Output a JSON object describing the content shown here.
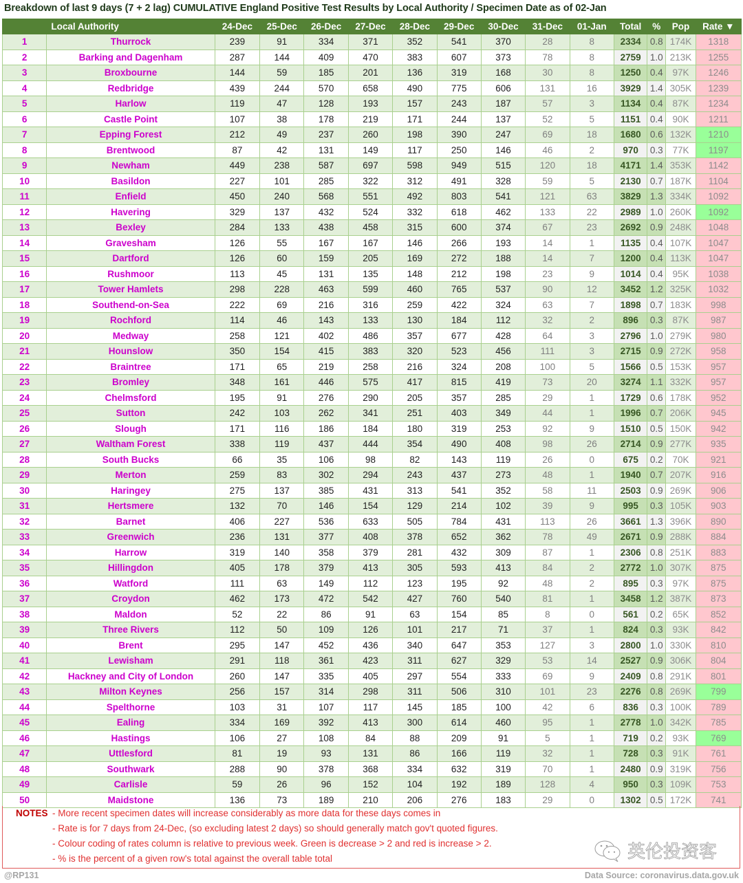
{
  "title": "Breakdown of last 9 days (7 + 2 lag)  CUMULATIVE England Positive Test Results by Local Authority / Specimen Date as of 02-Jan",
  "colors": {
    "header_bg": "#548235",
    "row_alt_bg": "#e2efda",
    "name_text": "#cc00cc",
    "rate_increase": "#ffc7ce",
    "rate_decrease": "#99ff99",
    "notes_text": "#e03030"
  },
  "chart_data": {
    "type": "table",
    "title": "Breakdown of last 9 days (7 + 2 lag)  CUMULATIVE England Positive Test Results by Local Authority / Specimen Date as of 02-Jan",
    "columns": [
      "",
      "Local Authority",
      "24-Dec",
      "25-Dec",
      "26-Dec",
      "27-Dec",
      "28-Dec",
      "29-Dec",
      "30-Dec",
      "31-Dec",
      "01-Jan",
      "Total",
      "%",
      "Pop",
      "Rate ▼"
    ],
    "header_label": "Local Authority",
    "day_headers": [
      "24-Dec",
      "25-Dec",
      "26-Dec",
      "27-Dec",
      "28-Dec",
      "29-Dec",
      "30-Dec",
      "31-Dec",
      "01-Jan"
    ],
    "total_header": "Total",
    "pct_header": "%",
    "pop_header": "Pop",
    "rate_header": "Rate ▼",
    "lag_days": 2,
    "rows": [
      {
        "rank": "1",
        "name": "Thurrock",
        "days": [
          239,
          91,
          334,
          371,
          352,
          541,
          370,
          28,
          8
        ],
        "total": "2334",
        "pct": "0.8",
        "pop": "174K",
        "rate": "1318",
        "rate_flag": "increase"
      },
      {
        "rank": "2",
        "name": "Barking and Dagenham",
        "days": [
          287,
          144,
          409,
          470,
          383,
          607,
          373,
          78,
          8
        ],
        "total": "2759",
        "pct": "1.0",
        "pop": "213K",
        "rate": "1255",
        "rate_flag": "increase"
      },
      {
        "rank": "3",
        "name": "Broxbourne",
        "days": [
          144,
          59,
          185,
          201,
          136,
          319,
          168,
          30,
          8
        ],
        "total": "1250",
        "pct": "0.4",
        "pop": "97K",
        "rate": "1246",
        "rate_flag": "increase"
      },
      {
        "rank": "4",
        "name": "Redbridge",
        "days": [
          439,
          244,
          570,
          658,
          490,
          775,
          606,
          131,
          16
        ],
        "total": "3929",
        "pct": "1.4",
        "pop": "305K",
        "rate": "1239",
        "rate_flag": "increase"
      },
      {
        "rank": "5",
        "name": "Harlow",
        "days": [
          119,
          47,
          128,
          193,
          157,
          243,
          187,
          57,
          3
        ],
        "total": "1134",
        "pct": "0.4",
        "pop": "87K",
        "rate": "1234",
        "rate_flag": "increase"
      },
      {
        "rank": "6",
        "name": "Castle Point",
        "days": [
          107,
          38,
          178,
          219,
          171,
          244,
          137,
          52,
          5
        ],
        "total": "1151",
        "pct": "0.4",
        "pop": "90K",
        "rate": "1211",
        "rate_flag": "increase"
      },
      {
        "rank": "7",
        "name": "Epping Forest",
        "days": [
          212,
          49,
          237,
          260,
          198,
          390,
          247,
          69,
          18
        ],
        "total": "1680",
        "pct": "0.6",
        "pop": "132K",
        "rate": "1210",
        "rate_flag": "decrease"
      },
      {
        "rank": "8",
        "name": "Brentwood",
        "days": [
          87,
          42,
          131,
          149,
          117,
          250,
          146,
          46,
          2
        ],
        "total": "970",
        "pct": "0.3",
        "pop": "77K",
        "rate": "1197",
        "rate_flag": "decrease"
      },
      {
        "rank": "9",
        "name": "Newham",
        "days": [
          449,
          238,
          587,
          697,
          598,
          949,
          515,
          120,
          18
        ],
        "total": "4171",
        "pct": "1.4",
        "pop": "353K",
        "rate": "1142",
        "rate_flag": "increase"
      },
      {
        "rank": "10",
        "name": "Basildon",
        "days": [
          227,
          101,
          285,
          322,
          312,
          491,
          328,
          59,
          5
        ],
        "total": "2130",
        "pct": "0.7",
        "pop": "187K",
        "rate": "1104",
        "rate_flag": "increase"
      },
      {
        "rank": "11",
        "name": "Enfield",
        "days": [
          450,
          240,
          568,
          551,
          492,
          803,
          541,
          121,
          63
        ],
        "total": "3829",
        "pct": "1.3",
        "pop": "334K",
        "rate": "1092",
        "rate_flag": "increase"
      },
      {
        "rank": "12",
        "name": "Havering",
        "days": [
          329,
          137,
          432,
          524,
          332,
          618,
          462,
          133,
          22
        ],
        "total": "2989",
        "pct": "1.0",
        "pop": "260K",
        "rate": "1092",
        "rate_flag": "decrease"
      },
      {
        "rank": "13",
        "name": "Bexley",
        "days": [
          284,
          133,
          438,
          458,
          315,
          600,
          374,
          67,
          23
        ],
        "total": "2692",
        "pct": "0.9",
        "pop": "248K",
        "rate": "1048",
        "rate_flag": "increase"
      },
      {
        "rank": "14",
        "name": "Gravesham",
        "days": [
          126,
          55,
          167,
          167,
          146,
          266,
          193,
          14,
          1
        ],
        "total": "1135",
        "pct": "0.4",
        "pop": "107K",
        "rate": "1047",
        "rate_flag": "increase"
      },
      {
        "rank": "15",
        "name": "Dartford",
        "days": [
          126,
          60,
          159,
          205,
          169,
          272,
          188,
          14,
          7
        ],
        "total": "1200",
        "pct": "0.4",
        "pop": "113K",
        "rate": "1047",
        "rate_flag": "increase"
      },
      {
        "rank": "16",
        "name": "Rushmoor",
        "days": [
          113,
          45,
          131,
          135,
          148,
          212,
          198,
          23,
          9
        ],
        "total": "1014",
        "pct": "0.4",
        "pop": "95K",
        "rate": "1038",
        "rate_flag": "increase"
      },
      {
        "rank": "17",
        "name": "Tower Hamlets",
        "days": [
          298,
          228,
          463,
          599,
          460,
          765,
          537,
          90,
          12
        ],
        "total": "3452",
        "pct": "1.2",
        "pop": "325K",
        "rate": "1032",
        "rate_flag": "increase"
      },
      {
        "rank": "18",
        "name": "Southend-on-Sea",
        "days": [
          222,
          69,
          216,
          316,
          259,
          422,
          324,
          63,
          7
        ],
        "total": "1898",
        "pct": "0.7",
        "pop": "183K",
        "rate": "998",
        "rate_flag": "increase"
      },
      {
        "rank": "19",
        "name": "Rochford",
        "days": [
          114,
          46,
          143,
          133,
          130,
          184,
          112,
          32,
          2
        ],
        "total": "896",
        "pct": "0.3",
        "pop": "87K",
        "rate": "987",
        "rate_flag": "increase"
      },
      {
        "rank": "20",
        "name": "Medway",
        "days": [
          258,
          121,
          402,
          486,
          357,
          677,
          428,
          64,
          3
        ],
        "total": "2796",
        "pct": "1.0",
        "pop": "279K",
        "rate": "980",
        "rate_flag": "increase"
      },
      {
        "rank": "21",
        "name": "Hounslow",
        "days": [
          350,
          154,
          415,
          383,
          320,
          523,
          456,
          111,
          3
        ],
        "total": "2715",
        "pct": "0.9",
        "pop": "272K",
        "rate": "958",
        "rate_flag": "increase"
      },
      {
        "rank": "22",
        "name": "Braintree",
        "days": [
          171,
          65,
          219,
          258,
          216,
          324,
          208,
          100,
          5
        ],
        "total": "1566",
        "pct": "0.5",
        "pop": "153K",
        "rate": "957",
        "rate_flag": "increase"
      },
      {
        "rank": "23",
        "name": "Bromley",
        "days": [
          348,
          161,
          446,
          575,
          417,
          815,
          419,
          73,
          20
        ],
        "total": "3274",
        "pct": "1.1",
        "pop": "332K",
        "rate": "957",
        "rate_flag": "increase"
      },
      {
        "rank": "24",
        "name": "Chelmsford",
        "days": [
          195,
          91,
          276,
          290,
          205,
          357,
          285,
          29,
          1
        ],
        "total": "1729",
        "pct": "0.6",
        "pop": "178K",
        "rate": "952",
        "rate_flag": "increase"
      },
      {
        "rank": "25",
        "name": "Sutton",
        "days": [
          242,
          103,
          262,
          341,
          251,
          403,
          349,
          44,
          1
        ],
        "total": "1996",
        "pct": "0.7",
        "pop": "206K",
        "rate": "945",
        "rate_flag": "increase"
      },
      {
        "rank": "26",
        "name": "Slough",
        "days": [
          171,
          116,
          186,
          184,
          180,
          319,
          253,
          92,
          9
        ],
        "total": "1510",
        "pct": "0.5",
        "pop": "150K",
        "rate": "942",
        "rate_flag": "increase"
      },
      {
        "rank": "27",
        "name": "Waltham Forest",
        "days": [
          338,
          119,
          437,
          444,
          354,
          490,
          408,
          98,
          26
        ],
        "total": "2714",
        "pct": "0.9",
        "pop": "277K",
        "rate": "935",
        "rate_flag": "increase"
      },
      {
        "rank": "28",
        "name": "South Bucks",
        "days": [
          66,
          35,
          106,
          98,
          82,
          143,
          119,
          26,
          0
        ],
        "total": "675",
        "pct": "0.2",
        "pop": "70K",
        "rate": "921",
        "rate_flag": "increase"
      },
      {
        "rank": "29",
        "name": "Merton",
        "days": [
          259,
          83,
          302,
          294,
          243,
          437,
          273,
          48,
          1
        ],
        "total": "1940",
        "pct": "0.7",
        "pop": "207K",
        "rate": "916",
        "rate_flag": "increase"
      },
      {
        "rank": "30",
        "name": "Haringey",
        "days": [
          275,
          137,
          385,
          431,
          313,
          541,
          352,
          58,
          11
        ],
        "total": "2503",
        "pct": "0.9",
        "pop": "269K",
        "rate": "906",
        "rate_flag": "increase"
      },
      {
        "rank": "31",
        "name": "Hertsmere",
        "days": [
          132,
          70,
          146,
          154,
          129,
          214,
          102,
          39,
          9
        ],
        "total": "995",
        "pct": "0.3",
        "pop": "105K",
        "rate": "903",
        "rate_flag": "increase"
      },
      {
        "rank": "32",
        "name": "Barnet",
        "days": [
          406,
          227,
          536,
          633,
          505,
          784,
          431,
          113,
          26
        ],
        "total": "3661",
        "pct": "1.3",
        "pop": "396K",
        "rate": "890",
        "rate_flag": "increase"
      },
      {
        "rank": "33",
        "name": "Greenwich",
        "days": [
          236,
          131,
          377,
          408,
          378,
          652,
          362,
          78,
          49
        ],
        "total": "2671",
        "pct": "0.9",
        "pop": "288K",
        "rate": "884",
        "rate_flag": "increase"
      },
      {
        "rank": "34",
        "name": "Harrow",
        "days": [
          319,
          140,
          358,
          379,
          281,
          432,
          309,
          87,
          1
        ],
        "total": "2306",
        "pct": "0.8",
        "pop": "251K",
        "rate": "883",
        "rate_flag": "increase"
      },
      {
        "rank": "35",
        "name": "Hillingdon",
        "days": [
          405,
          178,
          379,
          413,
          305,
          593,
          413,
          84,
          2
        ],
        "total": "2772",
        "pct": "1.0",
        "pop": "307K",
        "rate": "875",
        "rate_flag": "increase"
      },
      {
        "rank": "36",
        "name": "Watford",
        "days": [
          111,
          63,
          149,
          112,
          123,
          195,
          92,
          48,
          2
        ],
        "total": "895",
        "pct": "0.3",
        "pop": "97K",
        "rate": "875",
        "rate_flag": "increase"
      },
      {
        "rank": "37",
        "name": "Croydon",
        "days": [
          462,
          173,
          472,
          542,
          427,
          760,
          540,
          81,
          1
        ],
        "total": "3458",
        "pct": "1.2",
        "pop": "387K",
        "rate": "873",
        "rate_flag": "increase"
      },
      {
        "rank": "38",
        "name": "Maldon",
        "days": [
          52,
          22,
          86,
          91,
          63,
          154,
          85,
          8,
          0
        ],
        "total": "561",
        "pct": "0.2",
        "pop": "65K",
        "rate": "852",
        "rate_flag": "increase"
      },
      {
        "rank": "39",
        "name": "Three Rivers",
        "days": [
          112,
          50,
          109,
          126,
          101,
          217,
          71,
          37,
          1
        ],
        "total": "824",
        "pct": "0.3",
        "pop": "93K",
        "rate": "842",
        "rate_flag": "increase"
      },
      {
        "rank": "40",
        "name": "Brent",
        "days": [
          295,
          147,
          452,
          436,
          340,
          647,
          353,
          127,
          3
        ],
        "total": "2800",
        "pct": "1.0",
        "pop": "330K",
        "rate": "810",
        "rate_flag": "increase"
      },
      {
        "rank": "41",
        "name": "Lewisham",
        "days": [
          291,
          118,
          361,
          423,
          311,
          627,
          329,
          53,
          14
        ],
        "total": "2527",
        "pct": "0.9",
        "pop": "306K",
        "rate": "804",
        "rate_flag": "increase"
      },
      {
        "rank": "42",
        "name": "Hackney and City of London",
        "days": [
          260,
          147,
          335,
          405,
          297,
          554,
          333,
          69,
          9
        ],
        "total": "2409",
        "pct": "0.8",
        "pop": "291K",
        "rate": "801",
        "rate_flag": "increase"
      },
      {
        "rank": "43",
        "name": "Milton Keynes",
        "days": [
          256,
          157,
          314,
          298,
          311,
          506,
          310,
          101,
          23
        ],
        "total": "2276",
        "pct": "0.8",
        "pop": "269K",
        "rate": "799",
        "rate_flag": "decrease"
      },
      {
        "rank": "44",
        "name": "Spelthorne",
        "days": [
          103,
          31,
          107,
          117,
          145,
          185,
          100,
          42,
          6
        ],
        "total": "836",
        "pct": "0.3",
        "pop": "100K",
        "rate": "789",
        "rate_flag": "increase"
      },
      {
        "rank": "45",
        "name": "Ealing",
        "days": [
          334,
          169,
          392,
          413,
          300,
          614,
          460,
          95,
          1
        ],
        "total": "2778",
        "pct": "1.0",
        "pop": "342K",
        "rate": "785",
        "rate_flag": "increase"
      },
      {
        "rank": "46",
        "name": "Hastings",
        "days": [
          106,
          27,
          108,
          84,
          88,
          209,
          91,
          5,
          1
        ],
        "total": "719",
        "pct": "0.2",
        "pop": "93K",
        "rate": "769",
        "rate_flag": "decrease"
      },
      {
        "rank": "47",
        "name": "Uttlesford",
        "days": [
          81,
          19,
          93,
          131,
          86,
          166,
          119,
          32,
          1
        ],
        "total": "728",
        "pct": "0.3",
        "pop": "91K",
        "rate": "761",
        "rate_flag": "increase"
      },
      {
        "rank": "48",
        "name": "Southwark",
        "days": [
          288,
          90,
          378,
          368,
          334,
          632,
          319,
          70,
          1
        ],
        "total": "2480",
        "pct": "0.9",
        "pop": "319K",
        "rate": "756",
        "rate_flag": "increase"
      },
      {
        "rank": "49",
        "name": "Carlisle",
        "days": [
          59,
          26,
          96,
          152,
          104,
          192,
          189,
          128,
          4
        ],
        "total": "950",
        "pct": "0.3",
        "pop": "109K",
        "rate": "753",
        "rate_flag": "increase"
      },
      {
        "rank": "50",
        "name": "Maidstone",
        "days": [
          136,
          73,
          189,
          210,
          206,
          276,
          183,
          29,
          0
        ],
        "total": "1302",
        "pct": "0.5",
        "pop": "172K",
        "rate": "741",
        "rate_flag": "increase"
      }
    ]
  },
  "notes": {
    "label": "NOTES",
    "lines": [
      "- More recent specimen dates will increase considerably as more data for these days comes in",
      "- Rate is for 7 days from 24-Dec, (so excluding latest 2 days) so should generally match gov't quoted figures.",
      "- Colour coding of rates column is relative to previous week. Green is decrease > 2 and red is increase > 2.",
      "- % is the percent of a given row's total against the overall table total"
    ]
  },
  "watermark": {
    "icon": "wechat-icon",
    "text": "英伦投资客"
  },
  "footer": {
    "handle": "@RP131",
    "source": "Data Source: coronavirus.data.gov.uk"
  }
}
